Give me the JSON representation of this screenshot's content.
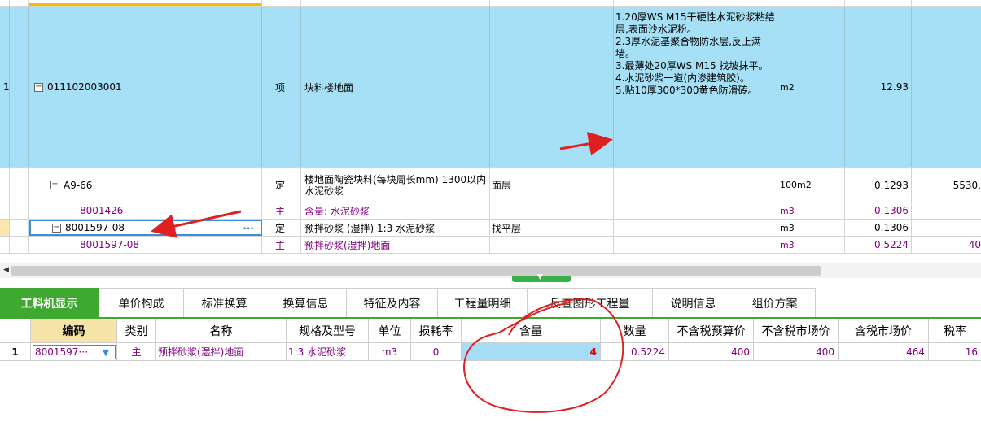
{
  "top_grid": {
    "rows": [
      {
        "num": "1",
        "code": "011102003001",
        "type": "项",
        "name": "块料楼地面",
        "feature": "",
        "desc": [
          "1.20厚WS M15干硬性水泥砂浆粘结层,表面沙水泥粉。",
          "2.3厚水泥基聚合物防水层,反上满墙。",
          "3.最薄处20厚WS M15 找坡抹平。",
          "4.水泥砂浆一道(内渗建筑胶)。",
          "5.贴10厚300*300黄色防滑砖。"
        ],
        "unit": "m2",
        "qty": "12.93",
        "price": ""
      },
      {
        "code": "A9-66",
        "type": "定",
        "name": "楼地面陶瓷块料(每块周长mm) 1300以内 水泥砂浆",
        "feature": "面层",
        "unit": "100m2",
        "qty": "0.1293",
        "price": "5530."
      },
      {
        "code": "8001426",
        "type": "主",
        "name": "含量: 水泥砂浆",
        "feature": "",
        "unit": "m3",
        "qty": "0.1306",
        "price": ""
      },
      {
        "code": "8001597-08",
        "type": "定",
        "name": "预拌砂浆 (湿拌) 1:3 水泥砂浆",
        "feature": "找平层",
        "unit": "m3",
        "qty": "0.1306",
        "price": ""
      },
      {
        "code": "8001597-08",
        "type": "主",
        "name": "预拌砂浆(湿拌)地面",
        "feature": "",
        "unit": "m3",
        "qty": "0.5224",
        "price": "40"
      }
    ]
  },
  "tabs": [
    "工料机显示",
    "单价构成",
    "标准换算",
    "换算信息",
    "特征及内容",
    "工程量明细",
    "反查图形工程量",
    "说明信息",
    "组价方案"
  ],
  "bottom_grid": {
    "headers": [
      "编码",
      "类别",
      "名称",
      "规格及型号",
      "单位",
      "损耗率",
      "含量",
      "数量",
      "不含税预算价",
      "不含税市场价",
      "含税市场价",
      "税率"
    ],
    "row": {
      "num": "1",
      "code": "8001597···",
      "type": "主",
      "name": "预拌砂浆(湿拌)地面",
      "spec": "1:3 水泥砂浆",
      "unit": "m3",
      "loss": "0",
      "content": "4",
      "qty": "0.5224",
      "budget_price": "400",
      "market_price": "400",
      "tax_market_price": "464",
      "tax_rate": "16"
    }
  },
  "colors": {
    "selected_row": "#a6e0f6",
    "tab_active": "#3fa830",
    "material_text": "#800080",
    "annotation_red": "#e02020"
  }
}
